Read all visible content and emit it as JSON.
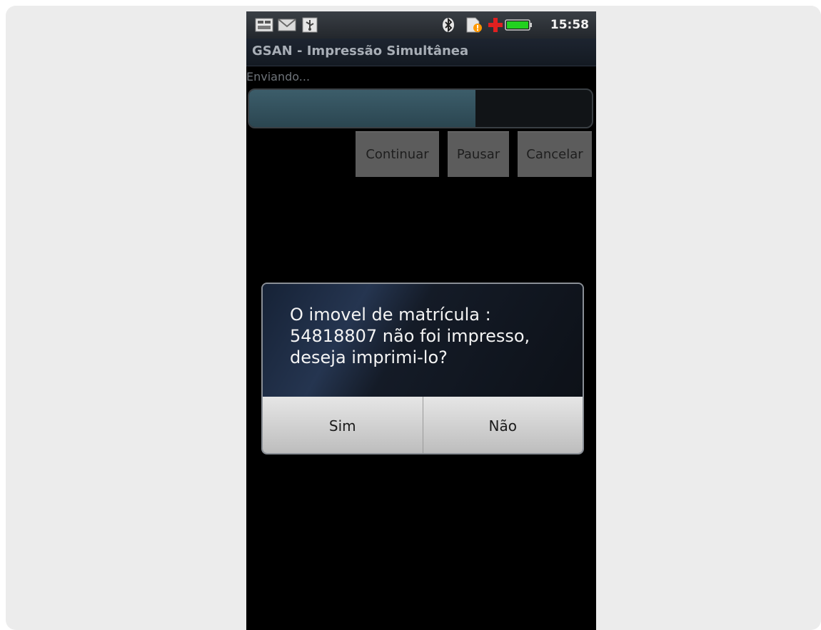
{
  "status_bar": {
    "icons": [
      "notification-icon",
      "mail-icon",
      "usb-icon",
      "bluetooth-icon",
      "sim-warning-icon",
      "medical-cross-icon",
      "battery-icon"
    ],
    "time": "15:58",
    "accent_battery": "#22d11f",
    "accent_cross": "#e02020",
    "accent_warning": "#ff9900"
  },
  "app": {
    "title": "GSAN - Impressão Simultânea",
    "status_text": "Enviando...",
    "progress": 0.66
  },
  "buttons": {
    "continue": "Continuar",
    "pause": "Pausar",
    "cancel": "Cancelar"
  },
  "dialog": {
    "message": "O imovel de matrícula : 54818807 não foi impresso, deseja imprimi-lo?",
    "yes": "Sim",
    "no": "Não"
  }
}
